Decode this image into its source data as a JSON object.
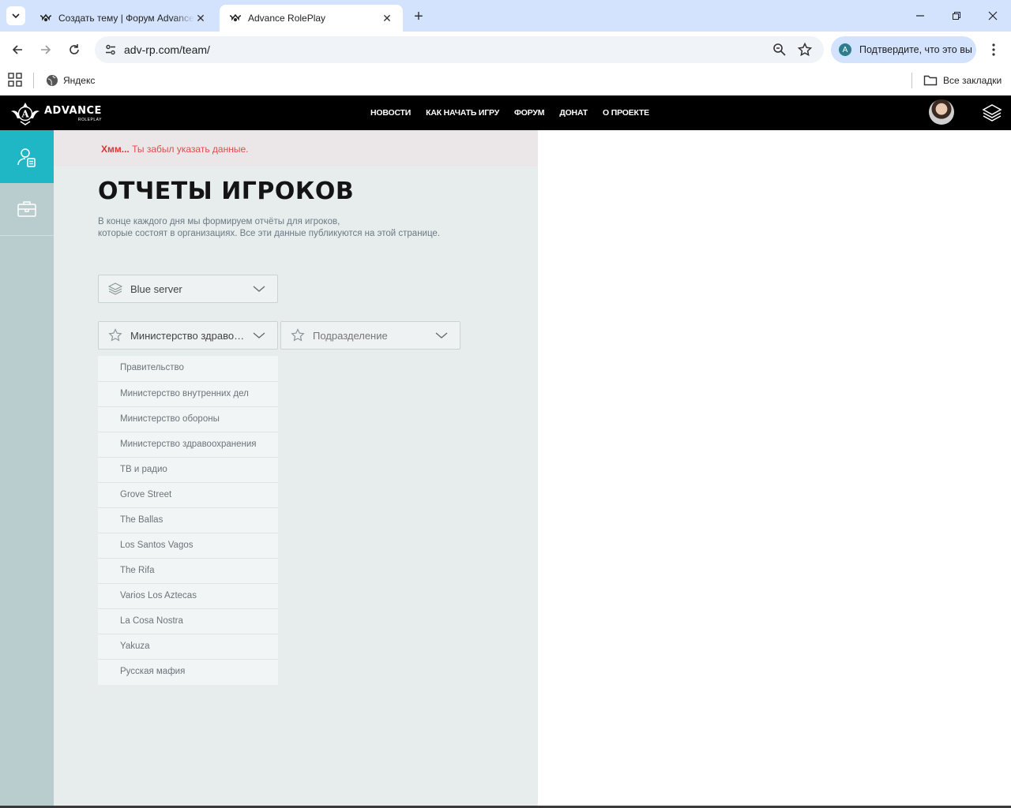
{
  "browser": {
    "tabs": [
      {
        "title": "Создать тему | Форум Advance RolePlay",
        "active": false
      },
      {
        "title": "Advance RolePlay",
        "active": true
      }
    ],
    "url": "adv-rp.com/team/",
    "verify_label": "Подтвердите, что это вы",
    "verify_avatar_letter": "A",
    "bookmarks": {
      "yandex": "Яндекс",
      "all": "Все закладки"
    }
  },
  "site": {
    "logo": {
      "brand": "ADVANCE",
      "sub": "ROLEPLAY",
      "letter": "A"
    },
    "nav": [
      "НОВОСТИ",
      "КАК НАЧАТЬ ИГРУ",
      "ФОРУМ",
      "ДОНАТ",
      "О ПРОЕКТЕ"
    ],
    "error": {
      "strong": "Хмм...",
      "text": " Ты забыл указать данные."
    },
    "title": "ОТЧЕТЫ ИГРОКОВ",
    "description_line1": "В конце каждого дня мы формируем отчёты для игроков,",
    "description_line2": "которые состоят в организациях. Все эти данные публикуются на этой странице.",
    "server_select": {
      "value": "Blue server"
    },
    "org_select": {
      "value": "Министерство здравоохранения"
    },
    "division_select": {
      "placeholder": "Подразделение"
    },
    "org_options": [
      "Правительство",
      "Министерство внутренних дел",
      "Министерство обороны",
      "Министерство здравоохранения",
      "ТВ и радио",
      "Grove Street",
      "The Ballas",
      "Los Santos Vagos",
      "The Rifa",
      "Varios Los Aztecas",
      "La Cosa Nostra",
      "Yakuza",
      "Русская мафия"
    ]
  },
  "colors": {
    "accent": "#1fb6c6",
    "sidebar": "#b9cdcf",
    "content_bg": "#e7ecec",
    "error": "#d93636",
    "chrome": "#d3e3fd"
  }
}
